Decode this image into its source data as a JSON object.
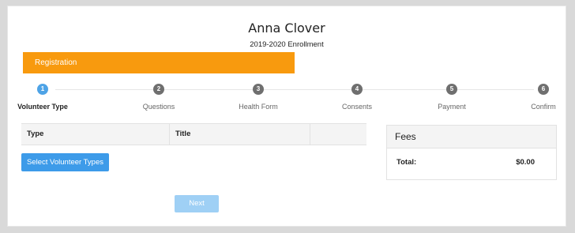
{
  "header": {
    "name": "Anna Clover",
    "subtitle": "2019-2020 Enrollment"
  },
  "registration": {
    "label": "Registration",
    "color": "#f89a0e"
  },
  "steps": [
    {
      "number": "1",
      "label": "Volunteer Type",
      "active": true
    },
    {
      "number": "2",
      "label": "Questions",
      "active": false
    },
    {
      "number": "3",
      "label": "Health Form",
      "active": false
    },
    {
      "number": "4",
      "label": "Consents",
      "active": false
    },
    {
      "number": "5",
      "label": "Payment",
      "active": false
    },
    {
      "number": "6",
      "label": "Confirm",
      "active": false
    }
  ],
  "volunteer_table": {
    "columns": [
      "Type",
      "Title",
      ""
    ]
  },
  "select_button": {
    "label": "Select Volunteer Types"
  },
  "fees": {
    "title": "Fees",
    "total_label": "Total:",
    "total_value": "$0.00"
  },
  "next_button": {
    "label": "Next"
  },
  "colors": {
    "accent": "#3d9be9",
    "active_step": "#4ea3e6",
    "inactive_step": "#6f6f6f"
  }
}
